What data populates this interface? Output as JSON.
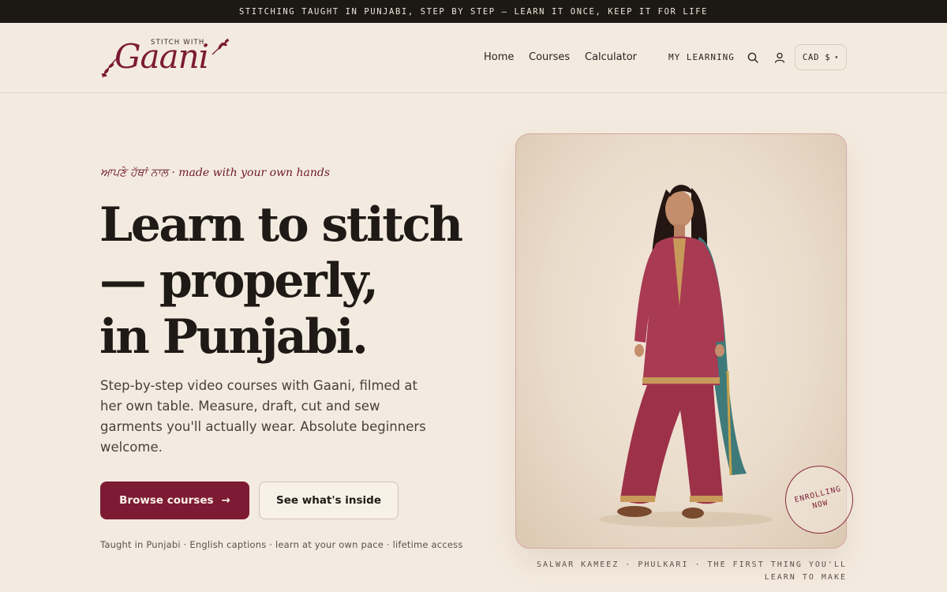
{
  "announcement": "STITCHING TAUGHT IN PUNJABI, STEP BY STEP — LEARN IT ONCE, KEEP IT FOR LIFE",
  "logo": {
    "small_text": "STITCH WITH",
    "script_text": "Gaani"
  },
  "nav": {
    "home": "Home",
    "courses": "Courses",
    "calculator": "Calculator",
    "my_learning": "MY LEARNING"
  },
  "currency": {
    "selected": "CAD $"
  },
  "hero": {
    "eyebrow": "ਆਪਣੇ ਹੱਥਾਂ ਨਾਲ · made with your own hands",
    "headline": [
      "Learn to stitch",
      "— properly,",
      "in Punjabi."
    ],
    "lede": "Step-by-step video courses with Gaani, filmed at her own table. Measure, draft, cut and sew garments you'll actually wear. Absolute beginners welcome.",
    "primary_cta": "Browse courses",
    "primary_cta_arrow": "→",
    "secondary_cta": "See what's inside",
    "trust_line": "Taught in Punjabi · English captions · learn at your own pace · lifetime access"
  },
  "hero_image": {
    "badge": [
      "ENROLLING",
      "NOW"
    ],
    "caption": [
      "SALWAR KAMEEZ · PHULKARI · THE FIRST THING YOU'LL",
      "LEARN TO MAKE"
    ]
  },
  "icons": {
    "search": "search-icon",
    "account": "user-icon",
    "dropdown": "chevron-down-icon"
  },
  "colors": {
    "accent": "#7d1a34",
    "background": "#f4ebe0",
    "announcement_bg": "#1c1814"
  }
}
